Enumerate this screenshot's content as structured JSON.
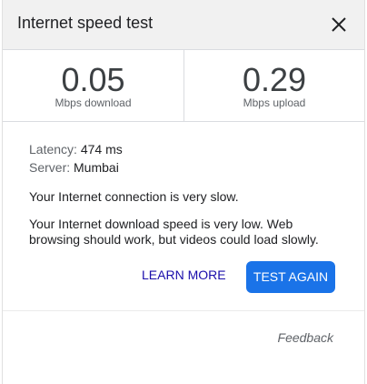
{
  "dialog": {
    "title": "Internet speed test",
    "close_icon": "close-icon"
  },
  "metrics": {
    "download": {
      "value": "0.05",
      "unit": "Mbps download"
    },
    "upload": {
      "value": "0.29",
      "unit": "Mbps upload"
    }
  },
  "details": {
    "latency_label": "Latency:",
    "latency_value": "474 ms",
    "server_label": "Server:",
    "server_value": "Mumbai",
    "summary": "Your Internet connection is very slow.",
    "detail_line1": "Your Internet download speed is very low. Web",
    "detail_line2": "browsing should work, but videos could load slowly."
  },
  "actions": {
    "learn_more": "LEARN MORE",
    "test_again": "TEST AGAIN"
  },
  "footer": {
    "feedback": "Feedback"
  },
  "colors": {
    "primary_button": "#1a73e8",
    "link": "#1a0dab",
    "header_bg": "#f1f1f1"
  }
}
